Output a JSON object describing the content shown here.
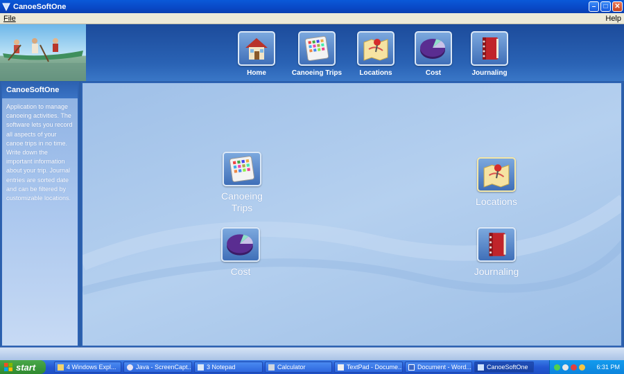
{
  "window": {
    "title": "CanoeSoftOne",
    "minimize_icon": "minimize-icon",
    "maximize_icon": "maximize-icon",
    "close_icon": "close-icon"
  },
  "menu": {
    "file": "File",
    "help": "Help"
  },
  "nav": {
    "items": [
      {
        "label": "Home",
        "icon": "house-icon"
      },
      {
        "label": "Canoeing Trips",
        "icon": "calculator-icon"
      },
      {
        "label": "Locations",
        "icon": "map-pin-icon"
      },
      {
        "label": "Cost",
        "icon": "pie-chart-icon"
      },
      {
        "label": "Journaling",
        "icon": "book-icon"
      }
    ]
  },
  "sidebar": {
    "title": "CanoeSoftOne",
    "description": "Application to manage canoeing activities. The software lets you record all aspects of your canoe trips in no time. Write down the important information about your trip. Journal entries are sorted date and can be filtered by customizable locations."
  },
  "tiles": {
    "trips": {
      "label": "Canoeing Trips",
      "icon": "calculator-icon"
    },
    "locations": {
      "label": "Locations",
      "icon": "map-pin-icon"
    },
    "cost": {
      "label": "Cost",
      "icon": "pie-chart-icon"
    },
    "journaling": {
      "label": "Journaling",
      "icon": "book-icon"
    }
  },
  "taskbar": {
    "start": "start",
    "tasks": [
      {
        "label": "4 Windows Expl..."
      },
      {
        "label": "Java - ScreenCapt..."
      },
      {
        "label": "3 Notepad"
      },
      {
        "label": "Calculator"
      },
      {
        "label": "TextPad - Docume..."
      },
      {
        "label": "Document - Word..."
      },
      {
        "label": "CanoeSoftOne"
      }
    ],
    "clock": "6:31 PM"
  },
  "colors": {
    "title_bar": "#0948c6",
    "header": "#2a63b5",
    "panel_border": "#2d62b2",
    "taskbar": "#2458d3",
    "start": "#3a9a3a"
  }
}
